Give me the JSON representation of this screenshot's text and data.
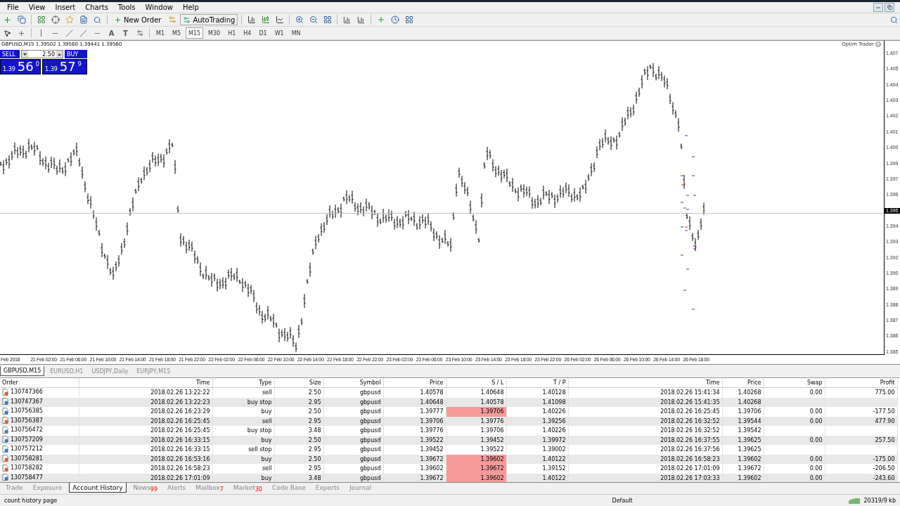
{
  "menu": [
    "File",
    "View",
    "Insert",
    "Charts",
    "Tools",
    "Window",
    "Help"
  ],
  "toolbar": {
    "new_order": "New Order",
    "auto_trading": "AutoTrading"
  },
  "drawing_tools": {
    "text_tool": "A",
    "label_tool": "T"
  },
  "timeframes": [
    {
      "label": "M1",
      "selected": false
    },
    {
      "label": "M5",
      "selected": false
    },
    {
      "label": "M15",
      "selected": true
    },
    {
      "label": "M30",
      "selected": false
    },
    {
      "label": "H1",
      "selected": false
    },
    {
      "label": "H4",
      "selected": false
    },
    {
      "label": "D1",
      "selected": false
    },
    {
      "label": "W1",
      "selected": false
    },
    {
      "label": "MN",
      "selected": false
    }
  ],
  "chart": {
    "header": "GBPUSD,M15  1.39502 1.39560 1.39441 1.39560",
    "expert": "Optim Trader",
    "one_click": {
      "sell": "SELL",
      "buy": "BUY",
      "lot": "2.50",
      "sell_big": "1.39",
      "sell_pips": "56",
      "sell_point": "0",
      "buy_big": "1.39",
      "buy_pips": "57",
      "buy_point": "9"
    },
    "price_labels": [
      {
        "text": "1.407",
        "current": false
      },
      {
        "text": "1.405",
        "current": false
      },
      {
        "text": "1.404",
        "current": false
      },
      {
        "text": "1.403",
        "current": false
      },
      {
        "text": "1.402",
        "current": false
      },
      {
        "text": "1.401",
        "current": false
      },
      {
        "text": "1.400",
        "current": false
      },
      {
        "text": "1.399",
        "current": false
      },
      {
        "text": "1.397",
        "current": false
      },
      {
        "text": "1.396",
        "current": false
      },
      {
        "text": "1.395",
        "current": true
      },
      {
        "text": "1.394",
        "current": false
      },
      {
        "text": "1.393",
        "current": false
      },
      {
        "text": "1.392",
        "current": false
      },
      {
        "text": "1.390",
        "current": false
      },
      {
        "text": "1.389",
        "current": false
      },
      {
        "text": "1.388",
        "current": false
      },
      {
        "text": "1.387",
        "current": false
      },
      {
        "text": "1.386",
        "current": false
      },
      {
        "text": "1.385",
        "current": false
      }
    ],
    "time_labels": [
      "Feb 2018",
      "21 Feb 02:00",
      "21 Feb 06:00",
      "21 Feb 10:00",
      "21 Feb 14:00",
      "21 Feb 18:00",
      "21 Feb 22:00",
      "22 Feb 02:00",
      "22 Feb 06:00",
      "22 Feb 10:00",
      "22 Feb 14:00",
      "22 Feb 18:00",
      "22 Feb 22:00",
      "23 Feb 02:00",
      "23 Feb 06:00",
      "23 Feb 10:00",
      "23 Feb 14:00",
      "23 Feb 18:00",
      "23 Feb 22:00",
      "26 Feb 02:00",
      "26 Feb 06:00",
      "26 Feb 10:00",
      "26 Feb 14:00",
      "26 Feb 18:00"
    ]
  },
  "chart_tabs": [
    {
      "label": "GBPUSD,M15",
      "selected": true
    },
    {
      "label": "EURUSD,H1",
      "selected": false
    },
    {
      "label": "USDJPY,Daily",
      "selected": false
    },
    {
      "label": "EURJPY,M15",
      "selected": false
    }
  ],
  "table": {
    "columns": [
      "Order",
      "Time",
      "Type",
      "Size",
      "Symbol",
      "Price",
      "S / L",
      "T / P",
      "Time",
      "Price",
      "Swap",
      "Profit"
    ],
    "rows": [
      {
        "color": "#e0601e",
        "cells": [
          "130747366",
          "2018.02.26 13:22:22",
          "sell",
          "2.50",
          "gbpusd",
          "1.40578",
          "1.40648",
          "1.40128",
          "2018.02.26 15:41:34",
          "1.40268",
          "0.00",
          "775.00"
        ],
        "sl_hit": false
      },
      {
        "color": "#2a7fd0",
        "cells": [
          "130747367",
          "2018.02.26 13:22:23",
          "buy stop",
          "2.95",
          "gbpusd",
          "1.40648",
          "1.40578",
          "1.41098",
          "2018.02.26 15:41:35",
          "1.40268",
          "",
          ""
        ],
        "sl_hit": false
      },
      {
        "color": "#2a7fd0",
        "cells": [
          "130756385",
          "2018.02.26 16:23:29",
          "buy",
          "2.50",
          "gbpusd",
          "1.39777",
          "1.39706",
          "1.40226",
          "2018.02.26 16:25:45",
          "1.39706",
          "0.00",
          "-177.50"
        ],
        "sl_hit": true
      },
      {
        "color": "#e0601e",
        "cells": [
          "130756387",
          "2018.02.26 16:25:45",
          "sell",
          "2.95",
          "gbpusd",
          "1.39706",
          "1.39776",
          "1.39256",
          "2018.02.26 16:32:52",
          "1.39544",
          "0.00",
          "477.90"
        ],
        "sl_hit": false
      },
      {
        "color": "#2a7fd0",
        "cells": [
          "130756472",
          "2018.02.26 16:25:45",
          "buy stop",
          "3.48",
          "gbpusd",
          "1.39776",
          "1.39706",
          "1.40226",
          "2018.02.26 16:32:52",
          "1.39542",
          "",
          ""
        ],
        "sl_hit": false
      },
      {
        "color": "#2a7fd0",
        "cells": [
          "130757209",
          "2018.02.26 16:33:15",
          "buy",
          "2.50",
          "gbpusd",
          "1.39522",
          "1.39452",
          "1.39972",
          "2018.02.26 16:37:55",
          "1.39625",
          "0.00",
          "257.50"
        ],
        "sl_hit": false
      },
      {
        "color": "#2a7fd0",
        "cells": [
          "130757212",
          "2018.02.26 16:33:15",
          "sell stop",
          "2.95",
          "gbpusd",
          "1.39452",
          "1.39522",
          "1.39002",
          "2018.02.26 16:37:56",
          "1.39625",
          "",
          ""
        ],
        "sl_hit": false
      },
      {
        "color": "#e0601e",
        "cells": [
          "130758281",
          "2018.02.26 16:53:16",
          "buy",
          "2.50",
          "gbpusd",
          "1.39672",
          "1.39602",
          "1.40122",
          "2018.02.26 16:58:23",
          "1.39602",
          "0.00",
          "-175.00"
        ],
        "sl_hit": true
      },
      {
        "color": "#e0601e",
        "cells": [
          "130758282",
          "2018.02.26 16:58:23",
          "sell",
          "2.95",
          "gbpusd",
          "1.39602",
          "1.39672",
          "1.39152",
          "2018.02.26 17:01:09",
          "1.39672",
          "0.00",
          "-206.50"
        ],
        "sl_hit": true
      },
      {
        "color": "#2a7fd0",
        "cells": [
          "130758477",
          "2018.02.26 17:01:09",
          "buy",
          "3.48",
          "gbpusd",
          "1.39672",
          "1.39602",
          "1.40122",
          "2018.02.26 17:03:33",
          "1.39602",
          "0.00",
          "-243.60"
        ],
        "sl_hit": true
      }
    ]
  },
  "terminal_tabs": [
    {
      "label": "Trade",
      "selected": false
    },
    {
      "label": "Exposure",
      "selected": false
    },
    {
      "label": "Account History",
      "selected": true
    },
    {
      "label": "News",
      "badge": "99",
      "selected": false
    },
    {
      "label": "Alerts",
      "selected": false
    },
    {
      "label": "Mailbox",
      "badge": "7",
      "selected": false
    },
    {
      "label": "Market",
      "badge": "30",
      "selected": false
    },
    {
      "label": "Code Base",
      "selected": false
    },
    {
      "label": "Experts",
      "selected": false
    },
    {
      "label": "Journal",
      "selected": false
    }
  ],
  "status_bar": {
    "hint": "count history page",
    "profile": "Default",
    "traffic": "20319/9 kb"
  }
}
